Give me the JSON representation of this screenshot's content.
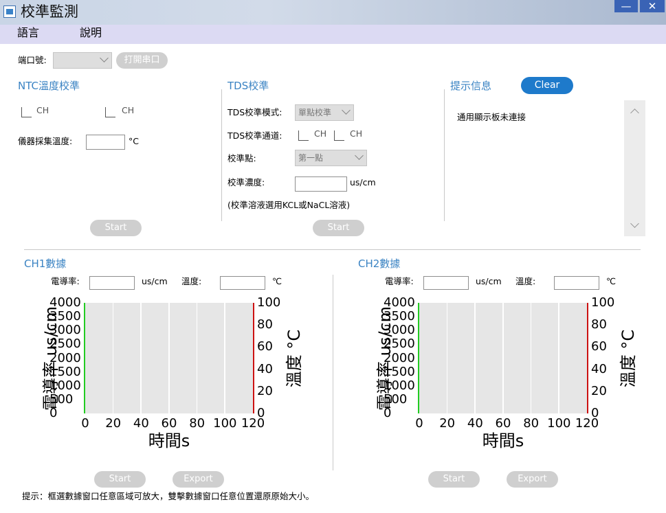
{
  "window": {
    "title": "校準監測",
    "minimize": "—",
    "close": "✕"
  },
  "menu": [
    "語言",
    "說明"
  ],
  "port": {
    "label": "端口號:",
    "selected": "",
    "open_button": "打開串口"
  },
  "ntc": {
    "title": "NTC溫度校準",
    "ch1_label": "CH",
    "ch2_label": "CH",
    "temp_label": "儀器採集溫度:",
    "temp_value": "",
    "temp_unit": "°C",
    "start_button": "Start"
  },
  "tds": {
    "title": "TDS校準",
    "mode_label": "TDS校準模式:",
    "mode_value": "單點校準",
    "channel_label": "TDS校準通道:",
    "ch1_label": "CH",
    "ch2_label": "CH",
    "point_label": "校準點:",
    "point_value": "第一點",
    "conc_label": "校準濃度:",
    "conc_value": "",
    "conc_unit": "us/cm",
    "note": "(校準溶液選用KCL或NaCL溶液)",
    "start_button": "Start"
  },
  "info": {
    "title": "提示信息",
    "clear_button": "Clear",
    "message": "通用顯示板未連接"
  },
  "ch1": {
    "title": "CH1數據",
    "cond_label": "電導率:",
    "cond_value": "",
    "cond_unit": "us/cm",
    "temp_label": "溫度:",
    "temp_value": "",
    "temp_unit": "℃",
    "start_button": "Start",
    "export_button": "Export"
  },
  "ch2": {
    "title": "CH2數據",
    "cond_label": "電導率:",
    "cond_value": "",
    "cond_unit": "us/cm",
    "temp_label": "溫度:",
    "temp_value": "",
    "temp_unit": "℃",
    "start_button": "Start",
    "export_button": "Export"
  },
  "footer_hint": "提示：框選數據窗口任意區域可放大，雙擊數據窗口任意位置還原原始大小。",
  "chart_data": [
    {
      "type": "line",
      "xlabel": "時間s",
      "ylabel": "電導率 us/cm",
      "y2label": "溫度 °C",
      "xlim": [
        0,
        120
      ],
      "ylim": [
        0,
        4000
      ],
      "y2lim": [
        0,
        100
      ],
      "x_ticks": [
        "0",
        "20",
        "40",
        "60",
        "80",
        "100",
        "120"
      ],
      "y_ticks": [
        "4000",
        "3500",
        "3000",
        "2500",
        "2000",
        "1500",
        "1000",
        "500",
        "0"
      ],
      "y2_ticks": [
        "100",
        "80",
        "60",
        "40",
        "20",
        "0"
      ],
      "series": [],
      "grid": "vertical",
      "colors": {
        "left_axis": "#22cc22",
        "right_axis": "#cc1111",
        "plot_bg": "#e6e6e6",
        "grid": "#ffffff"
      }
    },
    {
      "type": "line",
      "xlabel": "時間s",
      "ylabel": "電導率 us/cm",
      "y2label": "溫度 °C",
      "xlim": [
        0,
        120
      ],
      "ylim": [
        0,
        4000
      ],
      "y2lim": [
        0,
        100
      ],
      "x_ticks": [
        "0",
        "20",
        "40",
        "60",
        "80",
        "100",
        "120"
      ],
      "y_ticks": [
        "4000",
        "3500",
        "3000",
        "2500",
        "2000",
        "1500",
        "1000",
        "500",
        "0"
      ],
      "y2_ticks": [
        "100",
        "80",
        "60",
        "40",
        "20",
        "0"
      ],
      "series": [],
      "grid": "vertical",
      "colors": {
        "left_axis": "#22cc22",
        "right_axis": "#cc1111",
        "plot_bg": "#e6e6e6",
        "grid": "#ffffff"
      }
    }
  ]
}
